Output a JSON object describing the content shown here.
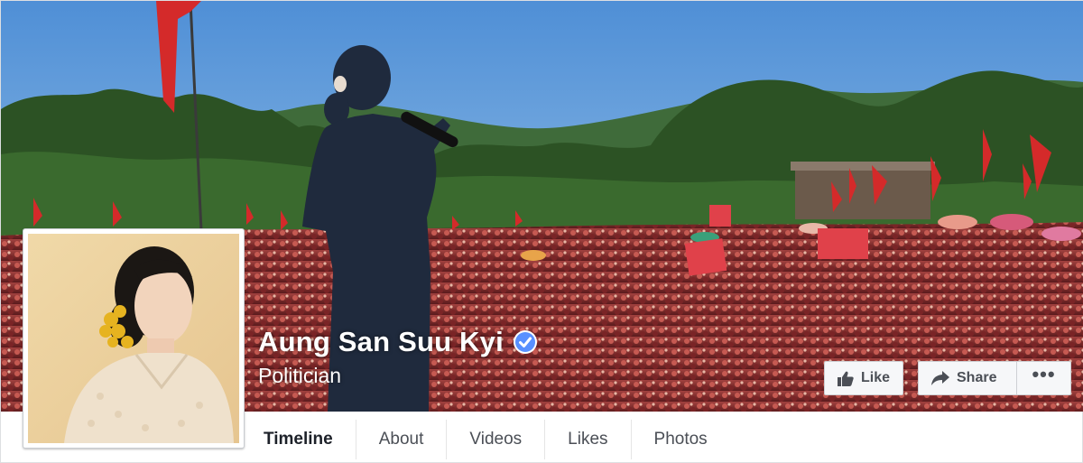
{
  "page": {
    "name": "Aung San Suu Kyi",
    "verified": true,
    "category": "Politician"
  },
  "actions": {
    "like_label": "Like",
    "share_label": "Share",
    "more_label": "•••"
  },
  "tabs": [
    {
      "label": "Timeline",
      "active": true
    },
    {
      "label": "About",
      "active": false
    },
    {
      "label": "Videos",
      "active": false
    },
    {
      "label": "Likes",
      "active": false
    },
    {
      "label": "Photos",
      "active": false
    }
  ],
  "icons": {
    "verified": "verified-check-icon",
    "like": "thumbs-up-icon",
    "share": "share-arrow-icon",
    "more": "more-dots-icon"
  },
  "colors": {
    "verified_badge": "#5890ff",
    "sky": "#7fb4e6",
    "crowd": "#8e2a2a",
    "flags": "#d42a2a"
  }
}
